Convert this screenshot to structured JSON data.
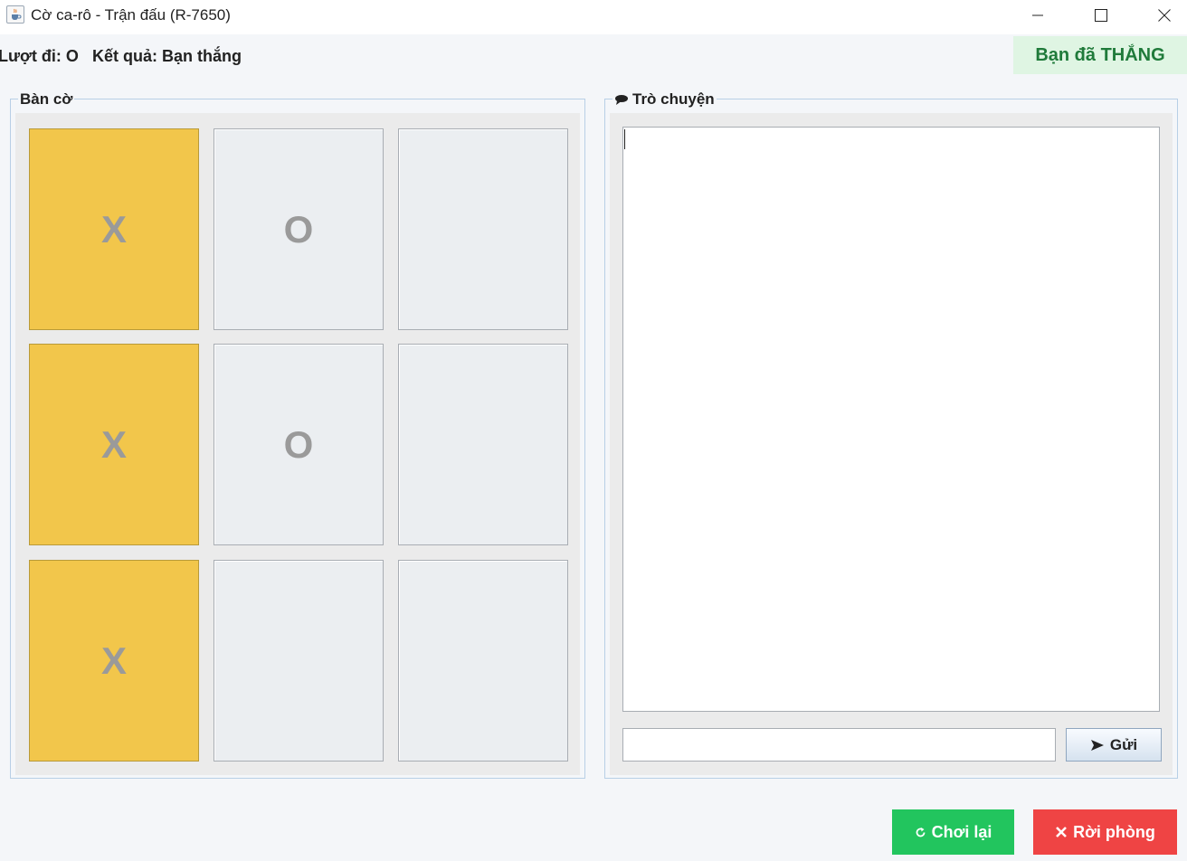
{
  "window": {
    "title": "Cờ ca-rô - Trận đấu (R-7650)",
    "icon": "java-cup-icon"
  },
  "status": {
    "turn_text": "Lượt đi: O",
    "result_text": "Kết quả: Bạn thắng",
    "banner_text": "Bạn đã THẮNG",
    "banner_color": "#1f7a3a",
    "banner_bg": "#dff5e3"
  },
  "board": {
    "title": "Bàn cờ",
    "cells": [
      {
        "mark": "X",
        "winning": true
      },
      {
        "mark": "O",
        "winning": false
      },
      {
        "mark": "",
        "winning": false
      },
      {
        "mark": "X",
        "winning": true
      },
      {
        "mark": "O",
        "winning": false
      },
      {
        "mark": "",
        "winning": false
      },
      {
        "mark": "X",
        "winning": true
      },
      {
        "mark": "",
        "winning": false
      },
      {
        "mark": "",
        "winning": false
      }
    ],
    "win_color": "#f2c64b"
  },
  "chat": {
    "title": "Trò chuyện",
    "title_icon": "speech-bubble-icon",
    "input_value": "",
    "send_label": "Gửi",
    "send_icon": "arrow-right-icon"
  },
  "actions": {
    "replay_label": "Chơi lại",
    "replay_icon": "refresh-icon",
    "replay_color": "#22c55e",
    "leave_label": "Rời phòng",
    "leave_icon": "close-icon",
    "leave_color": "#ef4444"
  }
}
